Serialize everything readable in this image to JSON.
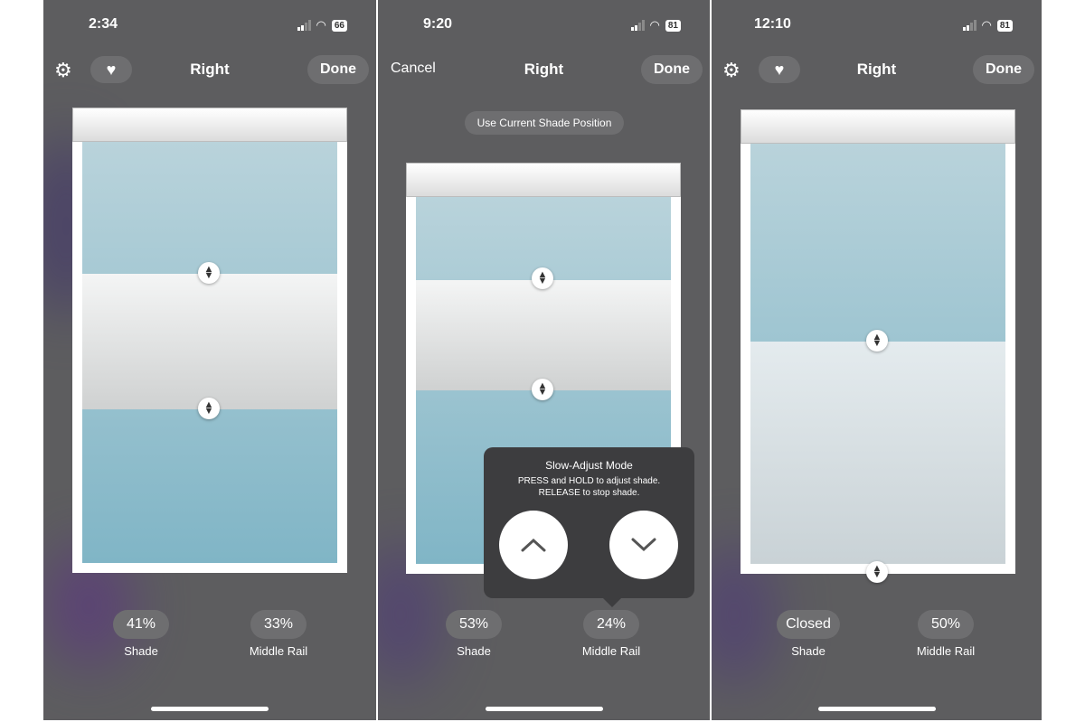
{
  "screens": [
    {
      "status": {
        "time": "2:34",
        "battery": "66"
      },
      "toolbar": {
        "title": "Right",
        "done_label": "Done",
        "settings_icon": "gear-icon",
        "favorite_icon": "heart-icon"
      },
      "shade_percent": 41,
      "middle_rail_percent": 33,
      "stats": {
        "shade_value": "41%",
        "shade_label": "Shade",
        "rail_value": "33%",
        "rail_label": "Middle Rail"
      }
    },
    {
      "status": {
        "time": "9:20",
        "battery": "81"
      },
      "toolbar": {
        "title": "Right",
        "done_label": "Done",
        "cancel_label": "Cancel"
      },
      "use_current_label": "Use Current Shade Position",
      "popup": {
        "title": "Slow-Adjust Mode",
        "line1": "PRESS and HOLD to adjust shade.",
        "line2": "RELEASE to stop shade.",
        "up_icon": "chevron-up-icon",
        "down_icon": "chevron-down-icon"
      },
      "shade_percent": 53,
      "middle_rail_percent": 24,
      "stats": {
        "shade_value": "53%",
        "shade_label": "Shade",
        "rail_value": "24%",
        "rail_label": "Middle Rail"
      }
    },
    {
      "status": {
        "time": "12:10",
        "battery": "81"
      },
      "toolbar": {
        "title": "Right",
        "done_label": "Done",
        "settings_icon": "gear-icon",
        "favorite_icon": "heart-icon"
      },
      "shade_percent": 100,
      "middle_rail_percent": 50,
      "stats": {
        "shade_value": "Closed",
        "shade_label": "Shade",
        "rail_value": "50%",
        "rail_label": "Middle Rail"
      }
    }
  ]
}
